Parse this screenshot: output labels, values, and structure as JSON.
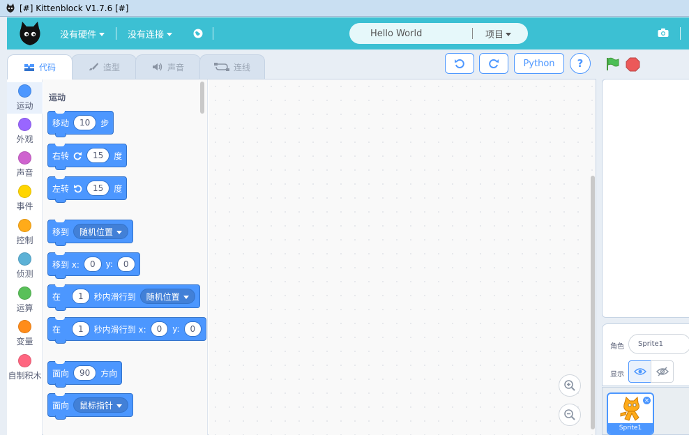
{
  "window": {
    "title": "[#] Kittenblock V1.7.6 [#]"
  },
  "menubar": {
    "hardware": "没有硬件",
    "connection": "没有连接",
    "project_name": "Hello World",
    "project_menu": "项目"
  },
  "tabs": [
    {
      "label": "代码",
      "active": true,
      "icon": "code-icon"
    },
    {
      "label": "造型",
      "active": false,
      "icon": "brush-icon"
    },
    {
      "label": "声音",
      "active": false,
      "icon": "speaker-icon"
    },
    {
      "label": "连线",
      "active": false,
      "icon": "wire-icon"
    }
  ],
  "toolbar": {
    "undo_icon": "undo-icon",
    "redo_icon": "redo-icon",
    "python_label": "Python",
    "help_label": "?"
  },
  "categories": [
    {
      "label": "运动",
      "color": "#4c97ff"
    },
    {
      "label": "外观",
      "color": "#9966ff"
    },
    {
      "label": "声音",
      "color": "#cf63cf"
    },
    {
      "label": "事件",
      "color": "#ffd500"
    },
    {
      "label": "控制",
      "color": "#ffab19"
    },
    {
      "label": "侦测",
      "color": "#5cb1d6"
    },
    {
      "label": "运算",
      "color": "#59c059"
    },
    {
      "label": "变量",
      "color": "#ff8c1a"
    },
    {
      "label": "自制积木",
      "color": "#ff6680"
    }
  ],
  "palette": {
    "section_title": "运动",
    "blocks": {
      "move": {
        "pre": "移动",
        "value": "10",
        "post": "步"
      },
      "turn_right": {
        "pre": "右转",
        "value": "15",
        "post": "度"
      },
      "turn_left": {
        "pre": "左转",
        "value": "15",
        "post": "度"
      },
      "goto": {
        "pre": "移到",
        "menu": "随机位置"
      },
      "goto_xy": {
        "pre": "移到 x:",
        "x": "0",
        "ylabel": "y:",
        "y": "0"
      },
      "glide": {
        "pre": "在",
        "secs": "1",
        "mid": "秒内滑行到",
        "menu": "随机位置"
      },
      "glide_xy": {
        "pre": "在",
        "secs": "1",
        "mid": "秒内滑行到 x:",
        "x": "0",
        "ylabel": "y:",
        "y": "0"
      },
      "point": {
        "pre": "面向",
        "value": "90",
        "post": "方向"
      },
      "point_towards": {
        "pre": "面向",
        "menu": "鼠标指针"
      }
    }
  },
  "sprite_info": {
    "sprite_label": "角色",
    "sprite_name": "Sprite1",
    "show_label": "显示"
  },
  "sprite_list": [
    {
      "name": "Sprite1",
      "selected": true
    }
  ]
}
